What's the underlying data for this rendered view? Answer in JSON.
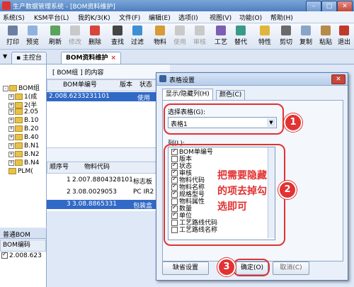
{
  "window": {
    "title": "生产数据管理系统 - [BOM资料维护]"
  },
  "menu": [
    "系统(S)",
    "KSM平台(L)",
    "我的K/3(K)",
    "文件(F)",
    "编辑(E)",
    "选项(I)",
    "视图(V)",
    "功能(O)",
    "帮助(H)"
  ],
  "toolbar": [
    "打印",
    "预览",
    "刷新",
    "修改",
    "删除",
    "查找",
    "过滤",
    "物料",
    "使用",
    "审核",
    "工艺",
    "替代",
    "特性",
    "剪切",
    "复制",
    "粘贴",
    "退出"
  ],
  "tabs": {
    "home": "主控台",
    "active": "BOM资料维护"
  },
  "tree": {
    "root": "BOM组",
    "items": [
      "1(成",
      "2(半",
      "2.05",
      "B.10",
      "B.20",
      "B.40",
      "B.N1",
      "B.N2",
      "B.N4",
      "PLM("
    ]
  },
  "bom_panel": {
    "header": "[ BOM组 ] 的内容",
    "columns": [
      "BOM单编号",
      "版本",
      "状态"
    ],
    "row": {
      "code": "2.008.6233231101",
      "status": "使用"
    }
  },
  "detail_grid": {
    "columns": [
      "顺序号",
      "物料代码",
      ""
    ],
    "rows": [
      {
        "seq": "1",
        "code": "2.007.8804328101",
        "name": "标志板"
      },
      {
        "seq": "2",
        "code": "3.08.0029053",
        "name": "PC IR2"
      },
      {
        "seq": "3",
        "code": "3.08.8865331",
        "name": "包装盒"
      }
    ]
  },
  "bottom_left": {
    "title": "普通BOM",
    "column": "BOM编码",
    "row": "2.008.623"
  },
  "dialog": {
    "title": "表格设置",
    "tabs": [
      "显示/隐藏列(H)",
      "颜色(C)"
    ],
    "select_label": "选择表格(G):",
    "select_value": "表格1",
    "column_label": "列(L):",
    "columns": [
      {
        "label": "BOM单编号",
        "checked": true
      },
      {
        "label": "版本",
        "checked": false
      },
      {
        "label": "状态",
        "checked": true
      },
      {
        "label": "审核",
        "checked": true
      },
      {
        "label": "物料代码",
        "checked": true
      },
      {
        "label": "物料名称",
        "checked": true
      },
      {
        "label": "规格型号",
        "checked": true
      },
      {
        "label": "物料属性",
        "checked": false
      },
      {
        "label": "数量",
        "checked": true
      },
      {
        "label": "单位",
        "checked": true
      },
      {
        "label": "工艺路线代码",
        "checked": false
      },
      {
        "label": "工艺路线名称",
        "checked": false
      }
    ],
    "buttons": {
      "default": "缺省设置",
      "ok": "确定(O)",
      "cancel": "取消(C)"
    }
  },
  "annotation": {
    "line1": "把需要隐藏",
    "line2": "的项去掉勾",
    "line3": "选即可",
    "step1": "1",
    "step2": "2",
    "step3": "3"
  },
  "colors": {
    "accent": "#3169c6",
    "annotation": "#e23232"
  }
}
